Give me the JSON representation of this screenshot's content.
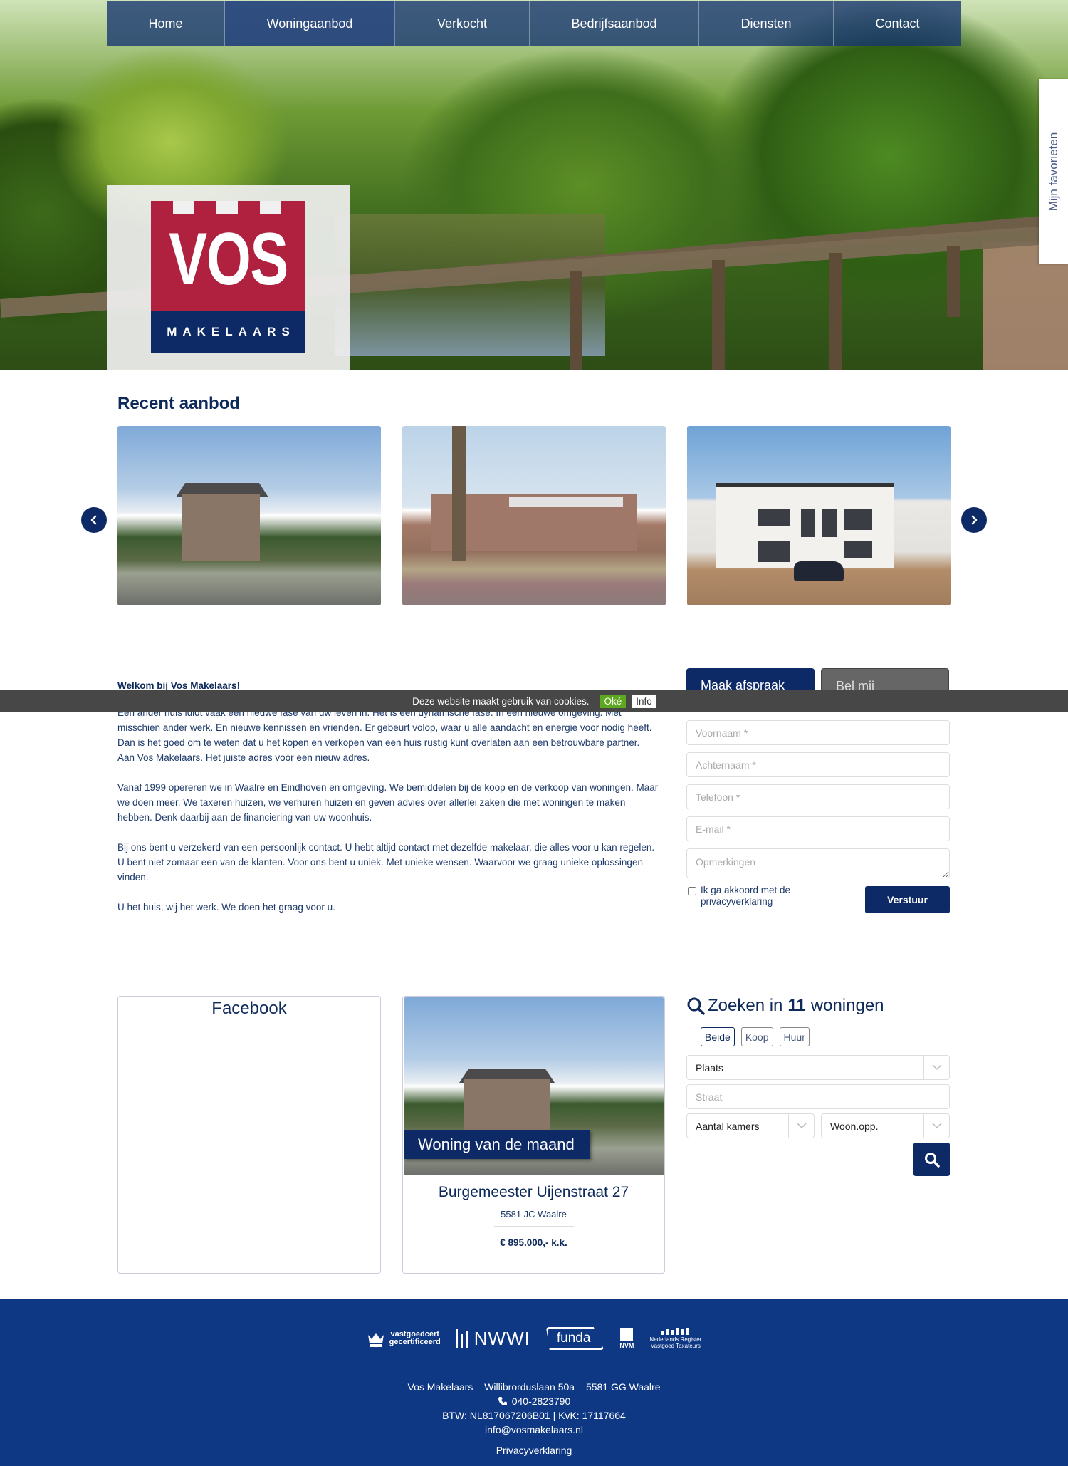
{
  "nav": {
    "items": [
      {
        "label": "Home"
      },
      {
        "label": "Woningaanbod"
      },
      {
        "label": "Verkocht"
      },
      {
        "label": "Bedrijfsaanbod"
      },
      {
        "label": "Diensten"
      },
      {
        "label": "Contact"
      }
    ],
    "active": "Woningaanbod"
  },
  "logo": {
    "main": "VOS",
    "sub": "MAKELAARS"
  },
  "favorites_tab": {
    "label": "Mijn favorieten"
  },
  "recent": {
    "title": "Recent aanbod",
    "prev_icon": "chevron-left-icon",
    "next_icon": "chevron-right-icon"
  },
  "welcome": {
    "heading": "Welkom bij Vos Makelaars!",
    "paragraphs": [
      "Een ander huis luidt vaak een nieuwe fase van uw leven in. Het is een dynamische fase. In een nieuwe omgeving. Met misschien ander werk. En nieuwe kennissen en vrienden. Er gebeurt volop, waar u alle aandacht en energie voor nodig heeft. Dan is het goed om te weten dat u het kopen en verkopen van een huis rustig kunt overlaten aan een betrouwbare partner. Aan Vos Makelaars. Het juiste adres voor een nieuw adres.",
      "Vanaf 1999 opereren we in Waalre en Eindhoven en omgeving. We bemiddelen bij de koop en de verkoop van woningen. Maar we doen meer. We taxeren huizen, we verhuren huizen en geven advies over allerlei zaken die met woningen te maken hebben. Denk daarbij aan de financiering van uw woonhuis.",
      "Bij ons bent u verzekerd van een persoonlijk contact. U hebt altijd contact met dezelfde makelaar, die alles voor u kan regelen. U bent niet zomaar een van de klanten. Voor ons bent u uniek. Met unieke wensen. Waarvoor we graag unieke oplossingen vinden.",
      "U het huis, wij het werk. We doen het graag voor u."
    ]
  },
  "cookie": {
    "text": "Deze website maakt gebruik van cookies.",
    "ok_label": "Oké",
    "info_label": "Info"
  },
  "contact_form": {
    "tabs": [
      {
        "label": "Maak afspraak"
      },
      {
        "label": "Bel mij"
      }
    ],
    "active_tab": "Maak afspraak",
    "fields": {
      "voornaam": {
        "placeholder": "Voornaam *",
        "value": ""
      },
      "achternaam": {
        "placeholder": "Achternaam *",
        "value": ""
      },
      "telefoon": {
        "placeholder": "Telefoon *",
        "value": ""
      },
      "email": {
        "placeholder": "E-mail *",
        "value": ""
      },
      "opmerkingen": {
        "placeholder": "Opmerkingen",
        "value": ""
      }
    },
    "privacy_label": "Ik ga akkoord met de privacyverklaring",
    "privacy_checked": false,
    "submit_label": "Verstuur"
  },
  "facebook": {
    "title": "Facebook"
  },
  "woning_van_de_maand": {
    "label": "Woning van de maand",
    "street": "Burgemeester Uijenstraat 27",
    "city": "5581 JC Waalre",
    "price": "€ 895.000,- k.k."
  },
  "search": {
    "title_prefix": "Zoeken in",
    "count": "11",
    "title_suffix": "woningen",
    "toggles": [
      {
        "label": "Beide"
      },
      {
        "label": "Koop"
      },
      {
        "label": "Huur"
      }
    ],
    "active_toggle": "Beide",
    "plaats": {
      "value": "Plaats"
    },
    "straat": {
      "placeholder": "Straat",
      "value": ""
    },
    "kamers": {
      "value": "Aantal kamers"
    },
    "woonopp": {
      "value": "Woon.opp."
    }
  },
  "footer": {
    "partners": [
      {
        "name": "vastgoedcert",
        "line1": "vastgoedcert",
        "line2": "gecertificeerd"
      },
      {
        "name": "NWWI",
        "label": "NWWI"
      },
      {
        "name": "funda",
        "label": "funda"
      },
      {
        "name": "NVM",
        "label": "NVM"
      },
      {
        "name": "NRVT",
        "line1": "Nederlands Register",
        "line2": "Vastgoed Taxateurs"
      }
    ],
    "company": "Vos Makelaars",
    "street": "Willibrorduslaan 50a",
    "postal_city": "5581 GG Waalre",
    "phone": "040-2823790",
    "btw_kvk": "BTW: NL817067206B01 | KvK: 17117664",
    "email": "info@vosmakelaars.nl",
    "privacy_label": "Privacyverklaring"
  },
  "colors": {
    "brand_blue": "#0e2a66",
    "brand_red": "#b0213f",
    "footer_blue": "#0e3784",
    "cookie_ok_green": "#5ca81e",
    "cookie_bar": "#474747"
  }
}
